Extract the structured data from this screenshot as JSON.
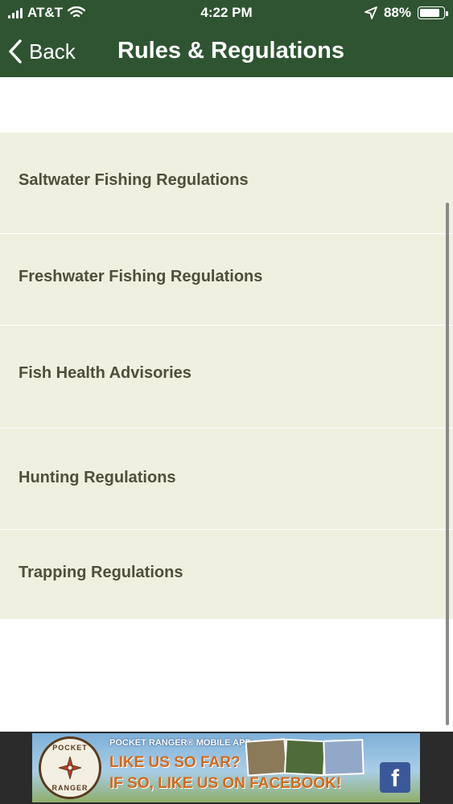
{
  "status_bar": {
    "carrier": "AT&T",
    "time": "4:22 PM",
    "battery": "88%",
    "battery_level": 0.88,
    "icons": [
      "signal-icon",
      "wifi-icon",
      "location-arrow-icon",
      "battery-icon"
    ]
  },
  "nav": {
    "back_label": "Back",
    "title": "Rules & Regulations"
  },
  "items": [
    {
      "label": "Saltwater Fishing Regulations"
    },
    {
      "label": "Freshwater Fishing Regulations"
    },
    {
      "label": "Fish Health Advisories"
    },
    {
      "label": "Hunting Regulations"
    },
    {
      "label": "Trapping Regulations"
    }
  ],
  "banner": {
    "logo_top": "POCKET",
    "logo_bottom": "RANGER",
    "app_label": "POCKET RANGER® MOBILE APP",
    "line1": "LIKE US SO FAR?",
    "line2": "IF SO, LIKE US ON FACEBOOK!",
    "fb_letter": "f"
  },
  "colors": {
    "header_green": "#2f5432",
    "list_background": "#f0f0e0",
    "item_text": "#4e4e3c"
  }
}
